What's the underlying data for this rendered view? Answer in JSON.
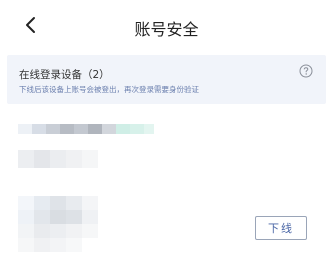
{
  "header": {
    "title": "账号安全",
    "back_icon": "chevron-left-icon"
  },
  "banner": {
    "title": "在线登录设备（2）",
    "subtitle": "下线后该设备上账号会被登出，再次登录需要身份验证",
    "help_icon": "question-circle-icon"
  },
  "devices": [
    {
      "name": "",
      "detail": ""
    },
    {
      "name": "",
      "detail": "",
      "logout_label": "下线"
    }
  ],
  "colors": {
    "banner_bg": "#f1f4fa",
    "banner_sub_text": "#6b7fae",
    "logout_text": "#4a66a6",
    "logout_border": "#9aa5b8"
  }
}
